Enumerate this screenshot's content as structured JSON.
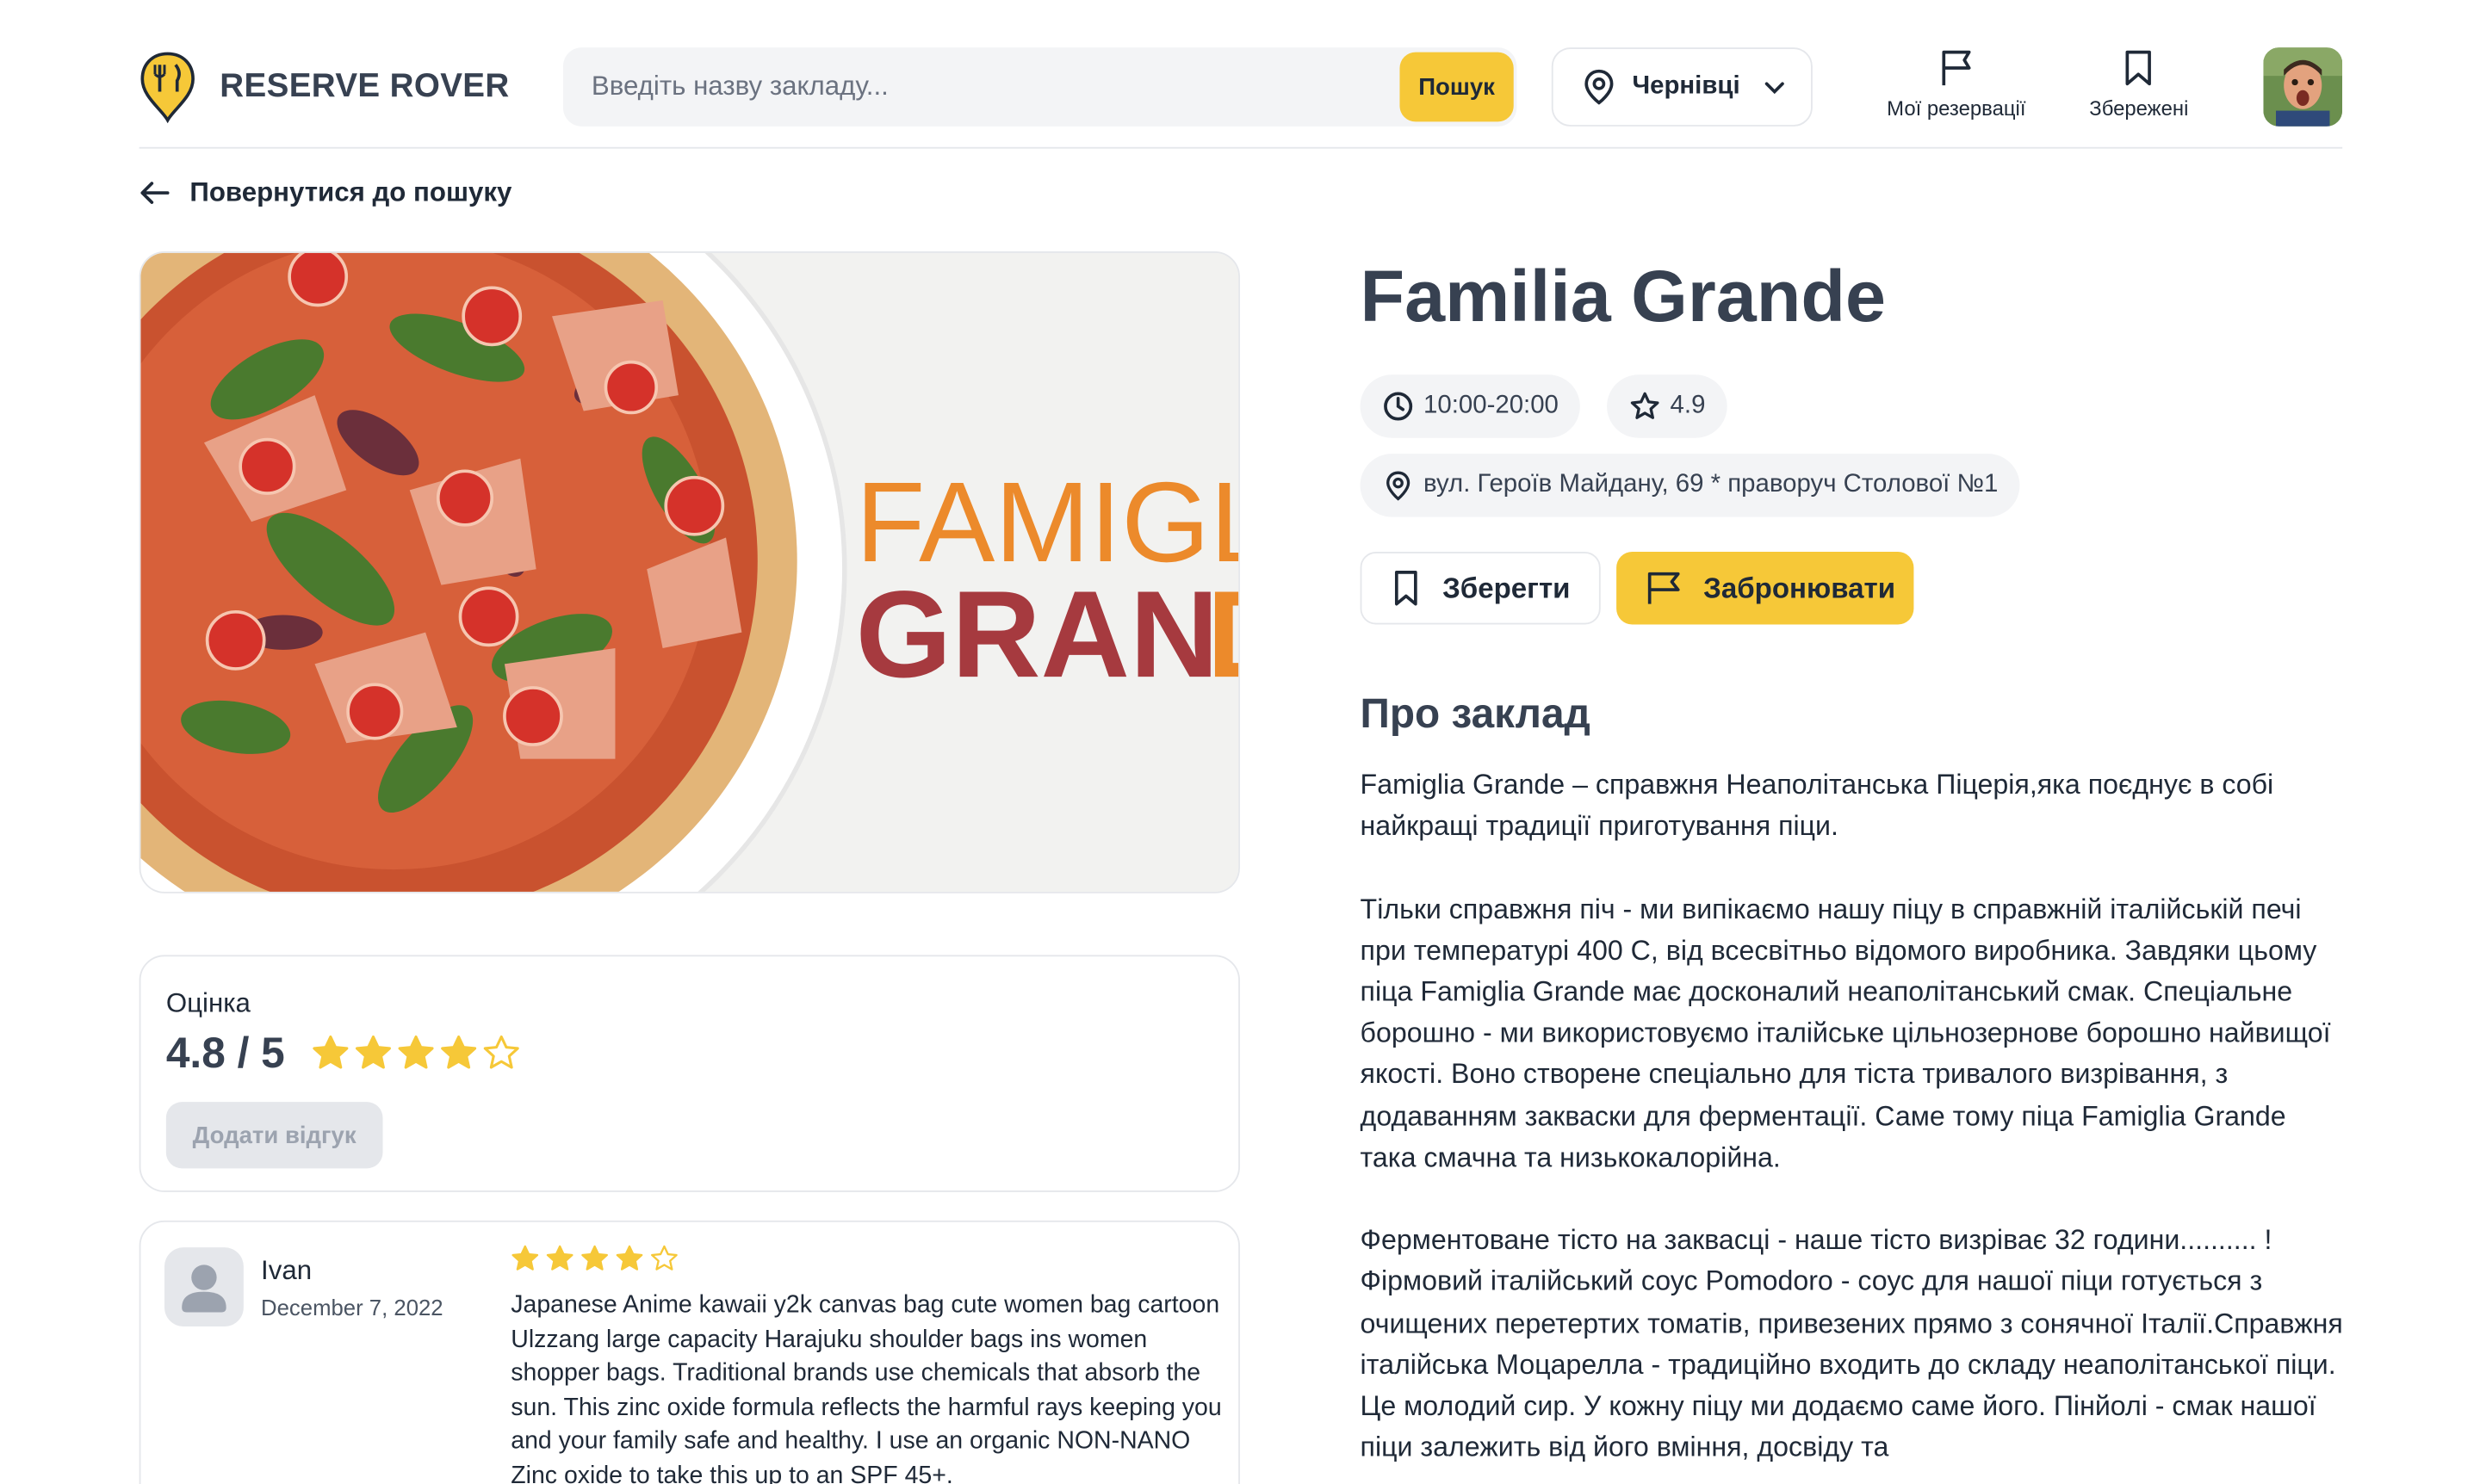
{
  "header": {
    "logo_text": "RESERVE ROVER",
    "search_placeholder": "Введіть назву закладу...",
    "search_button": "Пошук",
    "city": "Чернівці",
    "nav": [
      {
        "label": "Мої резервації",
        "icon": "flag-icon"
      },
      {
        "label": "Збережені",
        "icon": "bookmark-icon"
      }
    ]
  },
  "back_link": "Повернутися до пошуку",
  "hero": {
    "logo_line1": "FAMIGL",
    "logo_line2": "GRAN",
    "logo_line2_cut": "D"
  },
  "rating": {
    "title": "Оцінка",
    "value": "4.8 / 5",
    "stars_filled": 4,
    "stars_total": 5,
    "add_review": "Додати відгук"
  },
  "review": {
    "name": "Ivan",
    "date": "December 7, 2022",
    "stars_filled": 4,
    "text": "Japanese Anime kawaii y2k canvas bag cute women bag cartoon Ulzzang large capacity Harajuku shoulder bags ins women shopper bags. Traditional brands use chemicals that absorb the sun. This zinc oxide formula reflects the harmful rays keeping you and your family safe and healthy. I use an organic NON-NANO Zinc oxide to take this up to an SPF 45+."
  },
  "restaurant": {
    "name": "Familia Grande",
    "hours": "10:00-20:00",
    "rating": "4.9",
    "address": "вул. Героїв Майдану, 69 * праворуч Столової №1",
    "save_button": "Зберегти",
    "book_button": "Забронювати",
    "about_title": "Про заклад",
    "about_paragraphs": [
      "Famiglia Grande – справжня Неаполітанська Піцерія,яка поєднує в собі найкращі традиції приготування піци.",
      "Тільки справжня піч - ми випікаємо нашу піцу в справжній італійській печі при температурі 400 С, від всесвітньо відомого виробника. Завдяки цьому піца Famiglia Grande має досконалий неаполітанський смак. Спеціальне борошно - ми використовуємо італійське цільнозернове борошно найвищої якості. Воно створене спеціально для тіста тривалого визрівання, з додаванням закваски для ферментації. Саме тому піца Famiglia Grande така смачна та низькокалорійна.",
      "Ферментоване тісто на заквасці - наше тісто визріває 32 години.......... ! Фірмовий італійський соус Pomodoro - соус для нашої піци готується з очищених перетертих томатів, привезених прямо з сонячної Італії.Справжня італійська Моцарелла - традиційно входить до складу неаполітанської піци. Це молодий сир. У кожну піцу ми додаємо саме його. Пінйолі - смак нашої піци залежить від його вміння, досвіду та"
    ]
  },
  "colors": {
    "accent": "#f6c838",
    "text_dark": "#374151",
    "star": "#f6c838",
    "logo_orange": "#ec8a2b",
    "logo_red": "#a63a3f"
  }
}
